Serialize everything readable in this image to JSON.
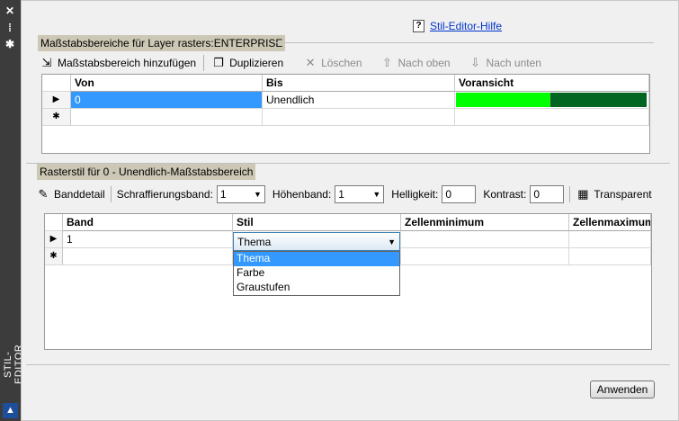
{
  "window": {
    "title": "STIL-EDITOR"
  },
  "help": {
    "label": "Stil-Editor-Hilfe",
    "icon": "?"
  },
  "section1": {
    "header": "Maßstabsbereiche für Layer rasters:ENTERPRISE",
    "toolbar": {
      "add": "Maßstabsbereich hinzufügen",
      "duplicate": "Duplizieren",
      "delete": "Löschen",
      "up": "Nach oben",
      "down": "Nach unten"
    },
    "columns": [
      "Von",
      "Bis",
      "Voransicht"
    ],
    "rows": [
      {
        "marker": "▶",
        "von": "0",
        "bis": "Unendlich"
      }
    ],
    "new_row_marker": "✱",
    "preview_colors": [
      "#00ff00",
      "#006622"
    ]
  },
  "section2": {
    "header": "Rasterstil für 0 - Unendlich-Maßstabsbereich",
    "toolbar": {
      "band_detail": "Banddetail",
      "hatch_band_label": "Schraffierungsband:",
      "hatch_band_value": "1",
      "height_band_label": "Höhenband:",
      "height_band_value": "1",
      "brightness_label": "Helligkeit:",
      "brightness_value": "0",
      "contrast_label": "Kontrast:",
      "contrast_value": "0",
      "transparent": "Transparent"
    },
    "columns": [
      "Band",
      "Stil",
      "Zellenminimum",
      "Zellenmaximum"
    ],
    "rows": [
      {
        "marker": "▶",
        "band": "1",
        "stil": "Thema"
      }
    ],
    "new_row_marker": "✱",
    "dropdown": {
      "selected": "Thema",
      "options": [
        "Thema",
        "Farbe",
        "Graustufen"
      ]
    }
  },
  "footer": {
    "apply": "Anwenden"
  }
}
